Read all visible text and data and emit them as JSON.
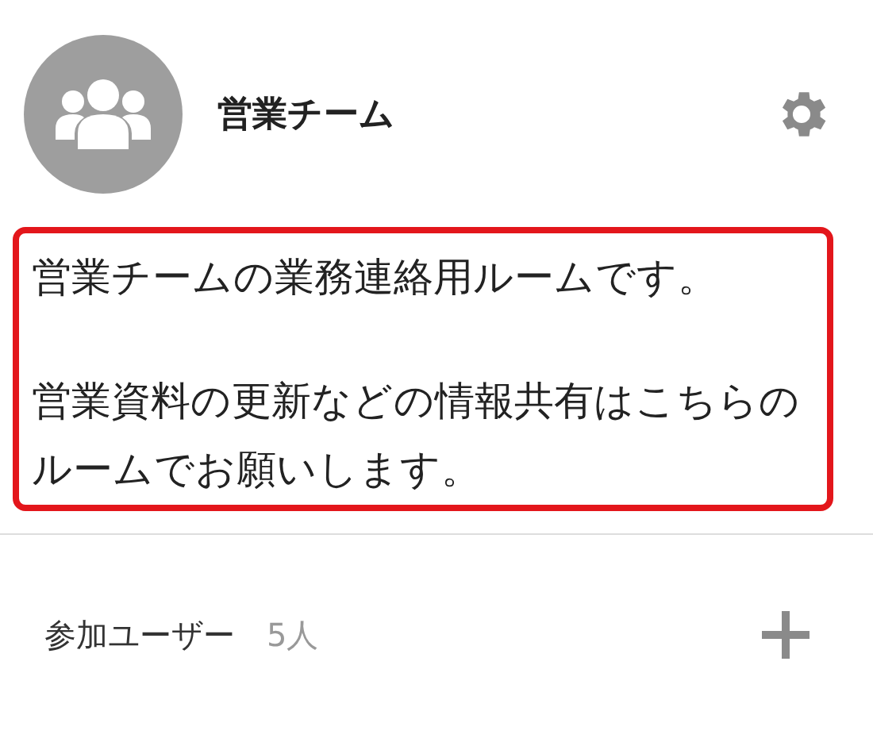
{
  "room": {
    "name": "営業チーム"
  },
  "description": [
    "営業チームの業務連絡用ルームです。",
    "営業資料の更新などの情報共有はこちらのルームでお願いします。"
  ],
  "members": {
    "label": "参加ユーザー",
    "count": "5人"
  }
}
